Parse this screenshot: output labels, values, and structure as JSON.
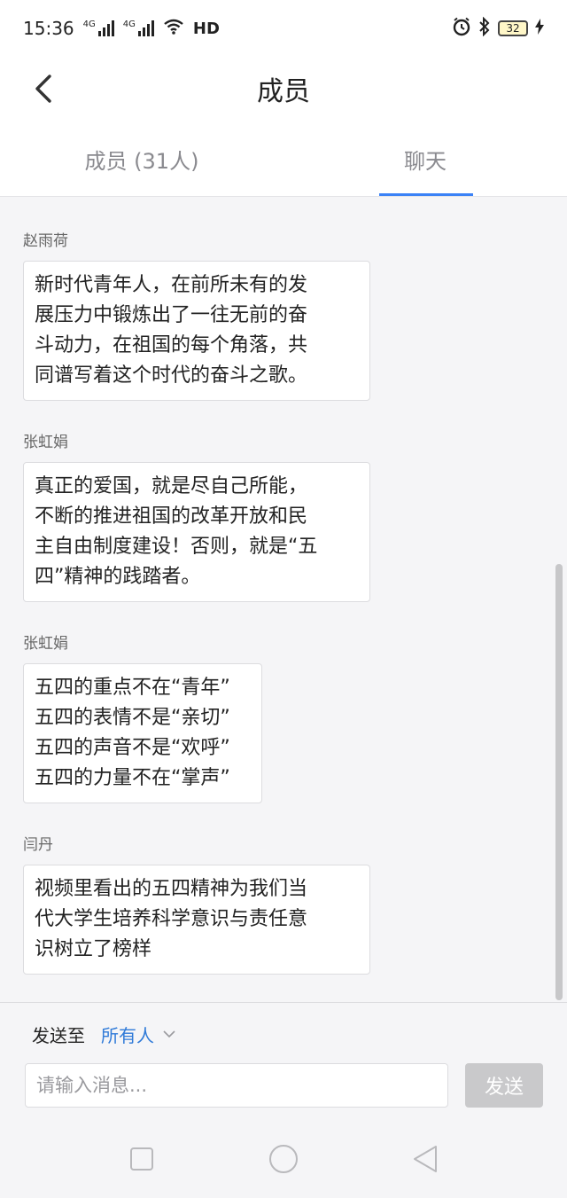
{
  "status_bar": {
    "time": "15:36",
    "network_1": "4G",
    "network_2": "4G",
    "hd_label": "HD",
    "battery_level": "32",
    "icons": [
      "signal-icon",
      "wifi-icon",
      "alarm-icon",
      "bluetooth-icon",
      "battery-icon",
      "charging-icon"
    ]
  },
  "header": {
    "title": "成员",
    "back_icon": "chevron-left-icon"
  },
  "tabs": [
    {
      "label": "成员 (31人)",
      "active": false
    },
    {
      "label": "聊天",
      "active": true
    }
  ],
  "messages": [
    {
      "sender": "赵雨荷",
      "text": "新时代青年人，在前所未有的发\n展压力中锻炼出了一往无前的奋\n斗动力，在祖国的每个角落，共\n同谱写着这个时代的奋斗之歌。"
    },
    {
      "sender": "张虹娟",
      "text": "真正的爱国，就是尽自己所能，\n不断的推进祖国的改革开放和民\n主自由制度建设！否则，就是“五\n四”精神的践踏者。"
    },
    {
      "sender": "张虹娟",
      "text": "五四的重点不在“青年”\n五四的表情不是“亲切”\n五四的声音不是“欢呼”\n五四的力量不在“掌声”"
    },
    {
      "sender": "闫丹",
      "text": "视频里看出的五四精神为我们当\n代大学生培养科学意识与责任意\n识树立了榜样"
    }
  ],
  "composer": {
    "send_to_label": "发送至",
    "recipient": "所有人",
    "input_placeholder": "请输入消息...",
    "input_value": "",
    "send_label": "发送"
  },
  "colors": {
    "accent": "#3b82f6",
    "recipient": "#2f7ad8",
    "send_disabled": "#c9c9cb",
    "background": "#f5f5f7"
  }
}
